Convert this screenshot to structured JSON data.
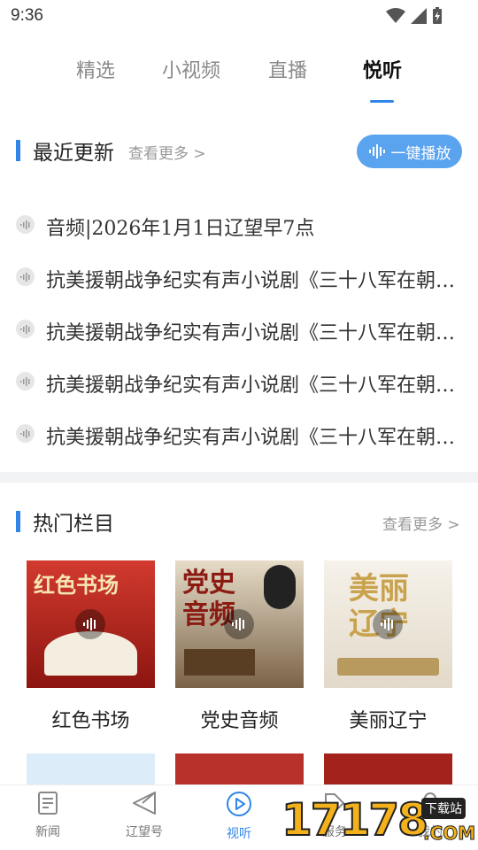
{
  "status": {
    "time": "9:36"
  },
  "tabs": [
    {
      "label": "精选"
    },
    {
      "label": "小视频"
    },
    {
      "label": "直播"
    },
    {
      "label": "悦听"
    }
  ],
  "recent": {
    "title": "最近更新",
    "more": "查看更多 >",
    "play_all": "一键播放",
    "items": [
      "音频|2026年1月1日辽望早7点",
      "抗美援朝战争纪实有声小说剧《三十八军在朝鲜》",
      "抗美援朝战争纪实有声小说剧《三十八军在朝鲜》",
      "抗美援朝战争纪实有声小说剧《三十八军在朝鲜》",
      "抗美援朝战争纪实有声小说剧《三十八军在朝鲜》"
    ]
  },
  "hot": {
    "title": "热门栏目",
    "more": "查看更多 >",
    "cards": [
      {
        "caption": "红色书场",
        "thumb_text": "红色书场",
        "color": "#c62a24"
      },
      {
        "caption": "党史音频",
        "thumb_text": "党史音频",
        "color": "#6b5a45"
      },
      {
        "caption": "美丽辽宁",
        "thumb_text": "美丽辽宁",
        "color": "#f1ece4"
      }
    ]
  },
  "bottom_nav": [
    {
      "label": "新闻",
      "icon": "news-icon"
    },
    {
      "label": "辽望号",
      "icon": "send-icon"
    },
    {
      "label": "视听",
      "icon": "play-circle-icon"
    },
    {
      "label": "服务",
      "icon": "tag-icon"
    },
    {
      "label": "我的",
      "icon": "user-icon"
    }
  ],
  "watermark": {
    "text": "17178",
    "sub": "下载站",
    "com": ".COM"
  },
  "colors": {
    "accent": "#2f86e8",
    "play_all_bg": "#5aa3ef"
  }
}
